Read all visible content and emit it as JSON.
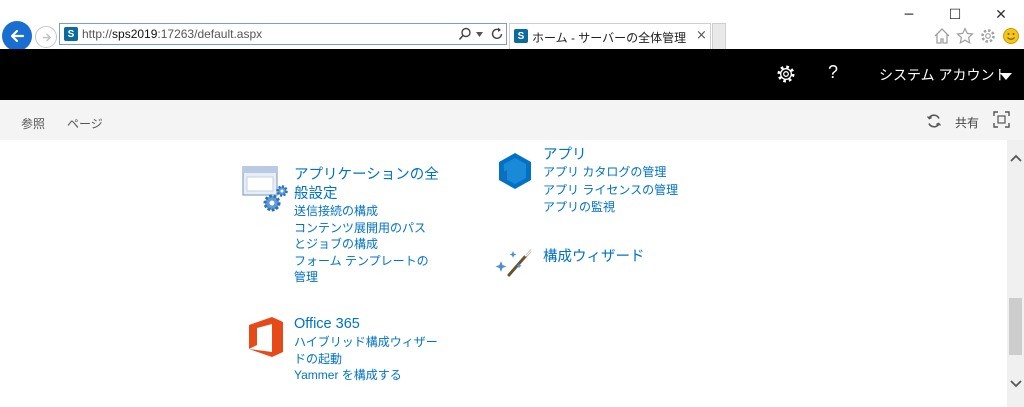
{
  "browser": {
    "url_prefix": "http://",
    "url_host": "sps2019",
    "url_suffix": ":17263/default.aspx",
    "tab_title": "ホーム - サーバーの全体管理",
    "tab_close": "×",
    "sp_glyph": "S",
    "window_controls": {
      "minimize": "─",
      "maximize": "☐",
      "close": "✕"
    },
    "toolbar_icons": [
      "home-icon",
      "favorites-star-icon",
      "tools-gear-icon",
      "smiley-feedback-icon"
    ]
  },
  "suite_bar": {
    "help_label": "?",
    "account_name": "システム アカウント"
  },
  "ribbon": {
    "tabs": [
      "参照",
      "ページ"
    ],
    "share_label": "共有"
  },
  "sections": {
    "general": {
      "heading_line1": "アプリケーションの全",
      "heading_line2": "般設定",
      "links": [
        [
          "送信接続の構成"
        ],
        [
          "コンテンツ展開用のパス",
          "とジョブの構成"
        ],
        [
          "フォーム テンプレートの",
          "管理"
        ]
      ]
    },
    "apps": {
      "heading": "アプリ",
      "links": [
        "アプリ カタログの管理",
        "アプリ ライセンスの管理",
        "アプリの監視"
      ]
    },
    "wizard": {
      "heading": "構成ウィザード"
    },
    "office365": {
      "heading": "Office 365",
      "links": [
        [
          "ハイブリッド構成ウィザー",
          "ドの起動"
        ],
        [
          "Yammer を構成する"
        ]
      ]
    }
  }
}
